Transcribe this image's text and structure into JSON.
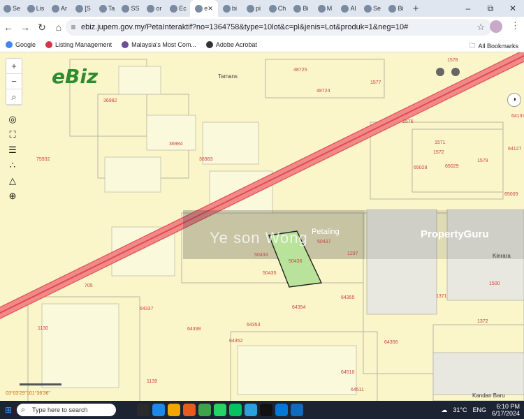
{
  "tabs": [
    "Se",
    "Lis",
    "Ar",
    "[S",
    "Ta",
    "SS",
    "or",
    "Ec",
    "e",
    "bi",
    "pi",
    "Ch",
    "Bi",
    "M",
    "Al",
    "Se",
    "Bi"
  ],
  "active_tab_label": "e",
  "window_controls": [
    "–",
    "⧉",
    "✕"
  ],
  "address_bar": {
    "url": "ebiz.jupem.gov.my/PetaInteraktif?no=1364758&type=10lot&c=pl&jenis=Lot&produk=1&neg=10#"
  },
  "bookmarks": [
    "Google",
    "Listing Management",
    "Malaysia's Most Com...",
    "Adobe Acrobat"
  ],
  "all_bookmarks_label": "All Bookmarks",
  "map": {
    "logo": "eBiz",
    "zoom_in": "+",
    "zoom_out": "−",
    "search_icon_text": "⌕",
    "area_labels": [
      "Tamans",
      "Petaling",
      "Kinrara",
      "Kandan Baru"
    ],
    "lots": [
      "48725",
      "48724",
      "1577",
      "1578",
      "36982",
      "36984",
      "36983",
      "75932",
      "1576",
      "1571",
      "1572",
      "65028",
      "65029",
      "1579",
      "64127",
      "65009",
      "64137",
      "50437",
      "1297",
      "50434",
      "50435",
      "50436",
      "705",
      "64337",
      "64338",
      "64353",
      "64354",
      "64355",
      "64356",
      "64352",
      "64510",
      "64511",
      "1139",
      "1130",
      "1372",
      "1500",
      "1371"
    ],
    "watermark_left": "Ye son Wong",
    "watermark_right": "PropertyGuru",
    "scale_label": "03°03'29\"101°36'36\""
  },
  "taskbar": {
    "search_placeholder": "Type here to search",
    "weather": "31°C",
    "language": "ENG",
    "time": "6:10 PM",
    "date": "6/17/2024"
  }
}
